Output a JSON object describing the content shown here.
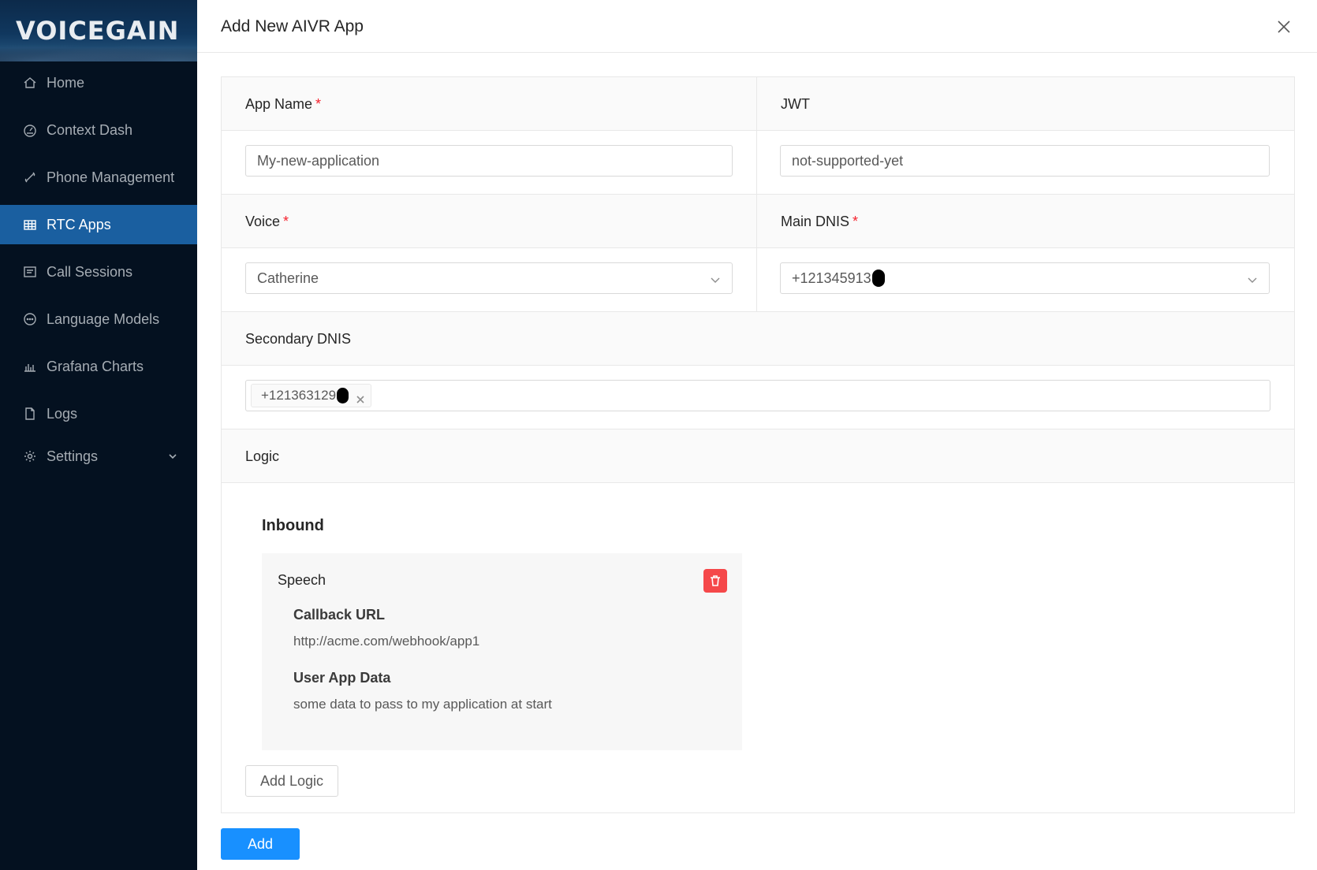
{
  "brand": {
    "logo_text": "VOICEGAIN"
  },
  "sidebar": {
    "items": [
      {
        "label": "Home",
        "icon": "home-icon"
      },
      {
        "label": "Context Dash",
        "icon": "dashboard-icon"
      },
      {
        "label": "Phone Management",
        "icon": "phone-icon"
      },
      {
        "label": "RTC Apps",
        "icon": "table-icon",
        "active": true
      },
      {
        "label": "Call Sessions",
        "icon": "sessions-icon"
      },
      {
        "label": "Language Models",
        "icon": "chat-icon"
      },
      {
        "label": "Grafana Charts",
        "icon": "bar-chart-icon"
      },
      {
        "label": "Logs",
        "icon": "file-icon"
      },
      {
        "label": "Settings",
        "icon": "gear-icon",
        "expandable": true
      }
    ]
  },
  "modal": {
    "title": "Add New AIVR App",
    "close_icon": "close-icon"
  },
  "form": {
    "app_name": {
      "label": "App Name",
      "required": "*",
      "value": "My-new-application"
    },
    "jwt": {
      "label": "JWT",
      "value": "not-supported-yet"
    },
    "voice": {
      "label": "Voice",
      "required": "*",
      "value": "Catherine"
    },
    "main_dnis": {
      "label": "Main DNIS",
      "required": "*",
      "value": "+121345913"
    },
    "secondary_dnis": {
      "label": "Secondary DNIS",
      "tags": [
        "+121363129"
      ]
    },
    "logic": {
      "label": "Logic",
      "section_title": "Inbound",
      "card": {
        "title": "Speech",
        "callback_label": "Callback URL",
        "callback_value": "http://acme.com/webhook/app1",
        "user_data_label": "User App Data",
        "user_data_value": "some data to pass to my application at start"
      },
      "add_logic_label": "Add Logic"
    }
  },
  "footer": {
    "submit_label": "Add"
  },
  "colors": {
    "sidebar_bg": "#041120",
    "active_item": "#1a5fa0",
    "primary": "#1890ff",
    "danger": "#f5484a",
    "required": "#f5222d"
  }
}
